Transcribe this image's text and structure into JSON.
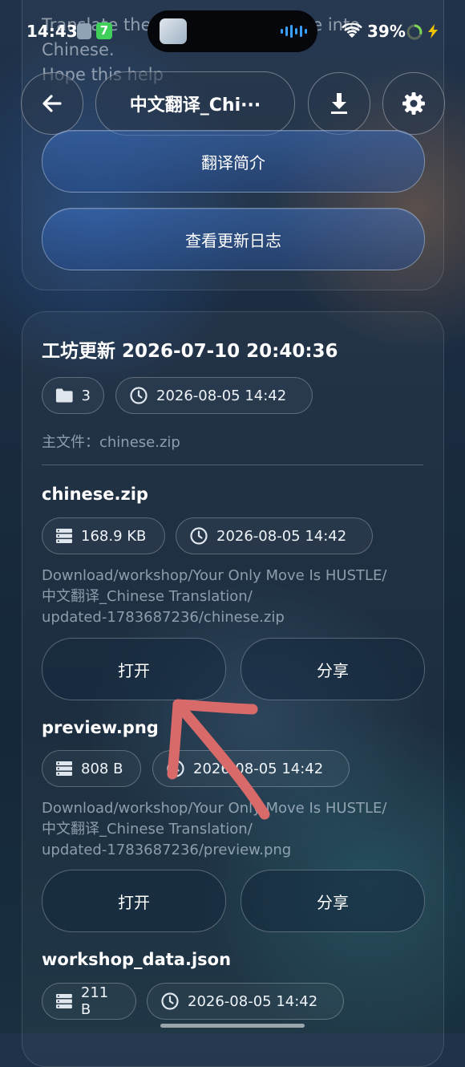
{
  "status_bar": {
    "time": "14:43",
    "battery": "39%",
    "badge_number": "7"
  },
  "background_text": {
    "line1": "Translate the text from the inside into",
    "line2": "Chinese.",
    "line3": "Hope this help"
  },
  "header": {
    "title": "中文翻译_Chi···"
  },
  "intro_card": {
    "translate_intro_button": "翻译简介",
    "changelog_button": "查看更新日志"
  },
  "workshop_update": {
    "title": "工坊更新 2026-07-10 20:40:36",
    "file_count": "3",
    "updated_at": "2026-08-05 14:42",
    "main_file_label": "主文件：chinese.zip"
  },
  "files": [
    {
      "name": "chinese.zip",
      "size": "168.9 KB",
      "time": "2026-08-05 14:42",
      "path_line1": "Download/workshop/Your Only Move Is HUSTLE/",
      "path_line2": "中文翻译_Chinese Translation/",
      "path_line3": "updated-1783687236/chinese.zip",
      "open_label": "打开",
      "share_label": "分享"
    },
    {
      "name": "preview.png",
      "size": "808 B",
      "time": "2026-08-05 14:42",
      "path_line1": "Download/workshop/Your Only Move Is HUSTLE/",
      "path_line2": "中文翻译_Chinese Translation/",
      "path_line3": "updated-1783687236/preview.png",
      "open_label": "打开",
      "share_label": "分享"
    },
    {
      "name": "workshop_data.json",
      "size": "211 B",
      "time": "2026-08-05 14:42"
    }
  ],
  "icons": {
    "back": "arrow-left-icon",
    "download": "download-icon",
    "settings": "gear-icon",
    "folder": "folder-icon",
    "clock": "clock-icon",
    "storage": "storage-icon"
  },
  "colors": {
    "annotation_arrow": "#d96a6a",
    "accent_button": "#3a6fb8"
  }
}
